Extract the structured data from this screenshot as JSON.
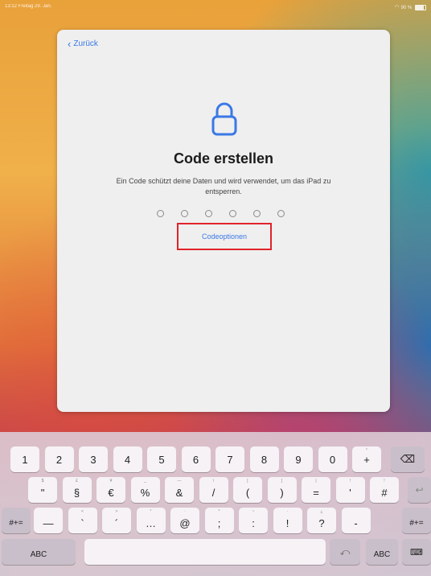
{
  "status": {
    "time_date": "13:12  Freitag 29. Jan.",
    "battery": "90 %"
  },
  "nav": {
    "back_label": "Zurück"
  },
  "content": {
    "title": "Code erstellen",
    "description": "Ein Code schützt deine Daten und wird verwendet, um das iPad zu entsperren.",
    "options_label": "Codeoptionen",
    "code_length": 6
  },
  "colors": {
    "accent": "#3a78e6",
    "highlight": "#e0232a"
  },
  "keyboard": {
    "row1": [
      "1",
      "2",
      "3",
      "4",
      "5",
      "6",
      "7",
      "8",
      "9",
      "0",
      "+"
    ],
    "row1_hints": [
      "",
      "",
      "",
      "",
      "",
      "",
      "",
      "",
      "",
      "",
      "°"
    ],
    "row2": [
      "\"",
      "§",
      "€",
      "%",
      "&",
      "/",
      "(",
      ")",
      "=",
      "'",
      "#"
    ],
    "row2_hints": [
      "$",
      "£",
      "¥",
      "_",
      "—",
      "\\",
      "[",
      "]",
      "|",
      "!",
      "!"
    ],
    "row3": [
      "—",
      "`",
      "´",
      "…",
      "@",
      ";",
      ":",
      "!",
      "?",
      "-"
    ],
    "row3_hints": [
      "",
      "<",
      ">",
      "°",
      "·",
      "*",
      "~",
      "·",
      "¿",
      ""
    ],
    "shift_label": "#+=",
    "abc_label": "ABC",
    "icons": [
      "delete-icon",
      "return-icon",
      "undo-icon",
      "keyboard-hide-icon"
    ]
  }
}
